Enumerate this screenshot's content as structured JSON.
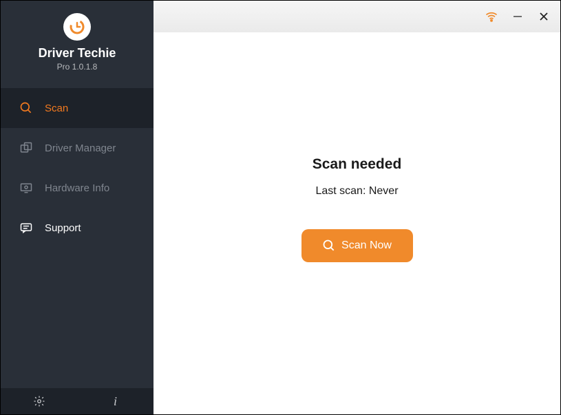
{
  "app": {
    "title": "Driver Techie",
    "version": "Pro 1.0.1.8"
  },
  "sidebar": {
    "items": [
      {
        "label": "Scan",
        "icon": "search-icon",
        "active": true
      },
      {
        "label": "Driver Manager",
        "icon": "manager-icon",
        "active": false
      },
      {
        "label": "Hardware Info",
        "icon": "hardware-icon",
        "active": false
      },
      {
        "label": "Support",
        "icon": "support-icon",
        "active": false
      }
    ]
  },
  "main": {
    "heading": "Scan needed",
    "last_scan_label": "Last scan: Never",
    "scan_button": "Scan Now"
  },
  "colors": {
    "accent": "#f08a2b",
    "sidebar_bg": "#292f38"
  }
}
